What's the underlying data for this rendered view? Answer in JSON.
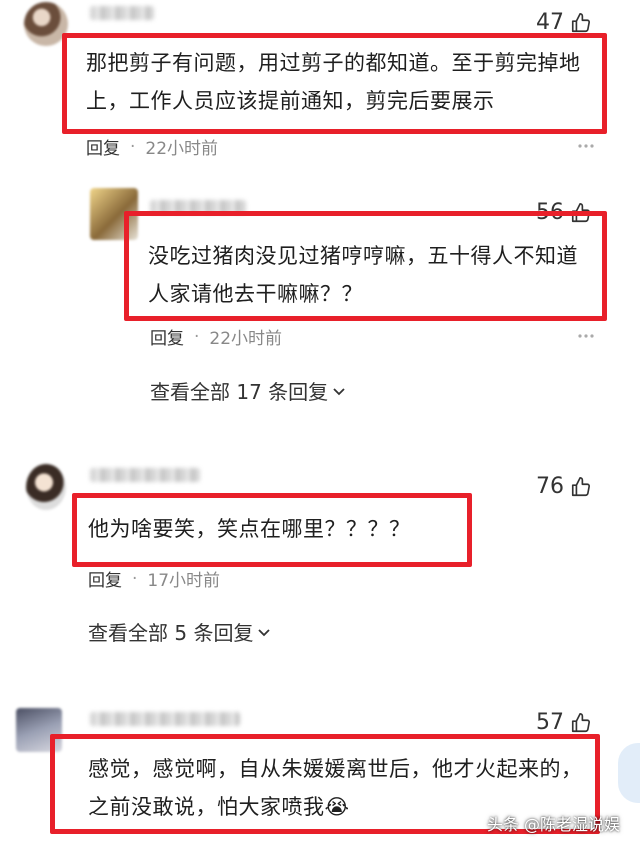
{
  "colors": {
    "highlight": "#e8202a",
    "text": "#1f1f1f",
    "muted": "#888888"
  },
  "comments": [
    {
      "likes": "47",
      "text_lines": [
        "那把剪子有问题，用过剪子的都知道。至于剪完掉地",
        "上，工作人员应该提前通知，剪完后要展示"
      ],
      "reply_label": "回复",
      "dot": "·",
      "time": "22小时前"
    },
    {
      "likes": "56",
      "text_lines": [
        "没吃过猪肉没见过猪哼哼嘛，五十得人不知道",
        "人家请他去干嘛嘛？？"
      ],
      "reply_label": "回复",
      "dot": "·",
      "time": "22小时前",
      "view_all": "查看全部 17 条回复"
    },
    {
      "likes": "76",
      "text_lines": [
        "他为啥要笑，笑点在哪里？？？？"
      ],
      "reply_label": "回复",
      "dot": "·",
      "time": "17小时前",
      "view_all": "查看全部 5 条回复"
    },
    {
      "likes": "57",
      "text_lines": [
        "感觉，感觉啊，自从朱媛媛离世后，他才火起来的，",
        "之前没敢说，怕大家喷我"
      ],
      "emoji": "😭"
    }
  ],
  "watermark": "头条 @陈老湿说娱",
  "icons": {
    "like": "thumbs-up-icon",
    "more": "more-options-icon",
    "chevron": "chevron-down-icon"
  }
}
